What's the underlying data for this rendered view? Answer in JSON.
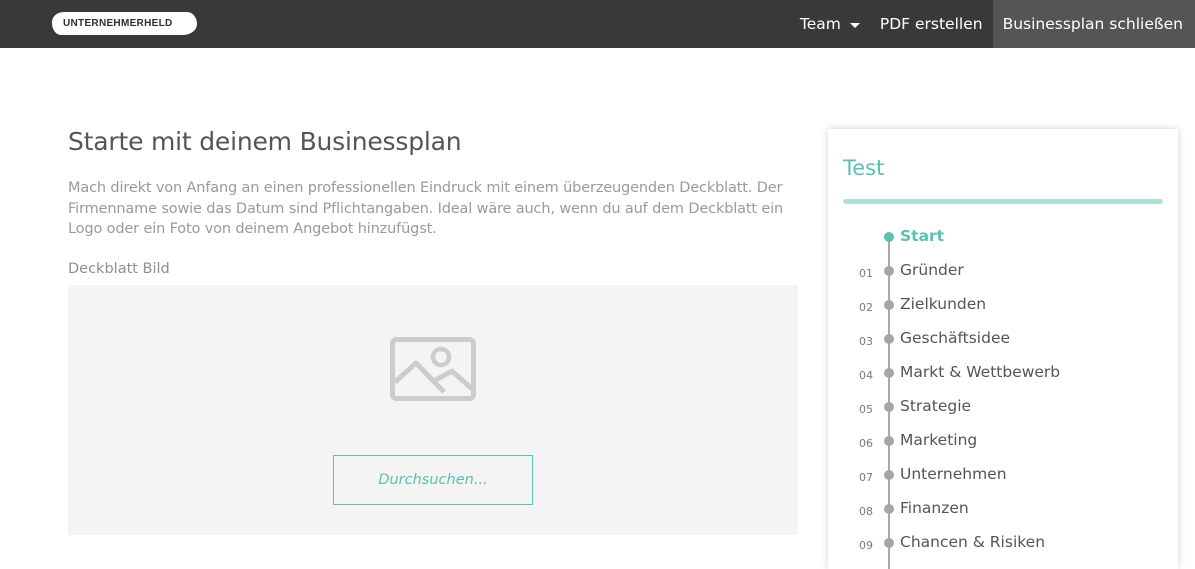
{
  "header": {
    "logo_text": "UNTERNEHMERHELD",
    "nav": {
      "team_label": "Team",
      "pdf_label": "PDF erstellen",
      "close_label": "Businessplan schließen"
    }
  },
  "main": {
    "title": "Starte mit deinem Businessplan",
    "intro": "Mach direkt von Anfang an einen professionellen Eindruck mit einem überzeugenden Deckblatt. Der Firmenname sowie das Datum sind Pflichtangaben. Ideal wäre auch, wenn du auf dem Deckblatt ein Logo oder ein Foto von deinem Angebot hinzufügst.",
    "cover_label": "Deckblatt Bild",
    "browse_label": "Durchsuchen..."
  },
  "sidebar": {
    "title": "Test",
    "progress": 1.0,
    "steps": [
      {
        "num": "",
        "label": "Start",
        "active": true
      },
      {
        "num": "01",
        "label": "Gründer",
        "active": false
      },
      {
        "num": "02",
        "label": "Zielkunden",
        "active": false
      },
      {
        "num": "03",
        "label": "Geschäftsidee",
        "active": false
      },
      {
        "num": "04",
        "label": "Markt & Wettbewerb",
        "active": false
      },
      {
        "num": "05",
        "label": "Strategie",
        "active": false
      },
      {
        "num": "06",
        "label": "Marketing",
        "active": false
      },
      {
        "num": "07",
        "label": "Unternehmen",
        "active": false
      },
      {
        "num": "08",
        "label": "Finanzen",
        "active": false
      },
      {
        "num": "09",
        "label": "Chancen & Risiken",
        "active": false
      }
    ]
  },
  "colors": {
    "topbar": "#393939",
    "accent": "#5cbfb3",
    "close_button_bg": "#555555"
  }
}
